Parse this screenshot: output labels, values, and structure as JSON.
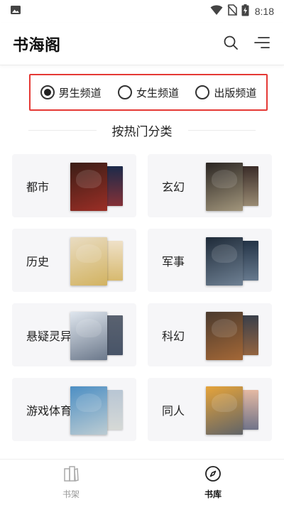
{
  "status_bar": {
    "time": "8:18",
    "icons": [
      "image-icon",
      "wifi-icon",
      "no-sim-icon",
      "battery-charging-icon"
    ]
  },
  "header": {
    "title": "书海阁",
    "actions": [
      "search-icon",
      "menu-icon"
    ]
  },
  "channels": {
    "selected": "男生频道",
    "options": [
      {
        "label": "男生频道",
        "checked": true
      },
      {
        "label": "女生频道",
        "checked": false
      },
      {
        "label": "出版频道",
        "checked": false
      }
    ]
  },
  "section_title": "按热门分类",
  "categories": [
    {
      "name": "都市",
      "front_color": "#3a1d16",
      "accent": "#c2352c",
      "back_color": "#1c2a4a"
    },
    {
      "name": "玄幻",
      "front_color": "#2a2522",
      "accent": "#d2c3a0",
      "back_color": "#3a2c28"
    },
    {
      "name": "历史",
      "front_color": "#e9dcc2",
      "accent": "#c9a23a",
      "back_color": "#efe1c8"
    },
    {
      "name": "军事",
      "front_color": "#1e2a38",
      "accent": "#8fa3b8",
      "back_color": "#243447"
    },
    {
      "name": "悬疑灵异",
      "front_color": "#dfe6ee",
      "accent": "#3d4c63",
      "back_color": "#5a6270"
    },
    {
      "name": "科幻",
      "front_color": "#4a3a2e",
      "accent": "#c87a3a",
      "back_color": "#3a3f4a"
    },
    {
      "name": "游戏体育",
      "front_color": "#4d8fc4",
      "accent": "#e8e4d8",
      "back_color": "#b8c6d4"
    },
    {
      "name": "同人",
      "front_color": "#e6a43a",
      "accent": "#2b4a7a",
      "back_color": "#e4b9a3"
    }
  ],
  "bottom_nav": {
    "items": [
      {
        "label": "书架",
        "icon": "bookshelf-icon",
        "active": false
      },
      {
        "label": "书库",
        "icon": "compass-icon",
        "active": true
      }
    ]
  }
}
